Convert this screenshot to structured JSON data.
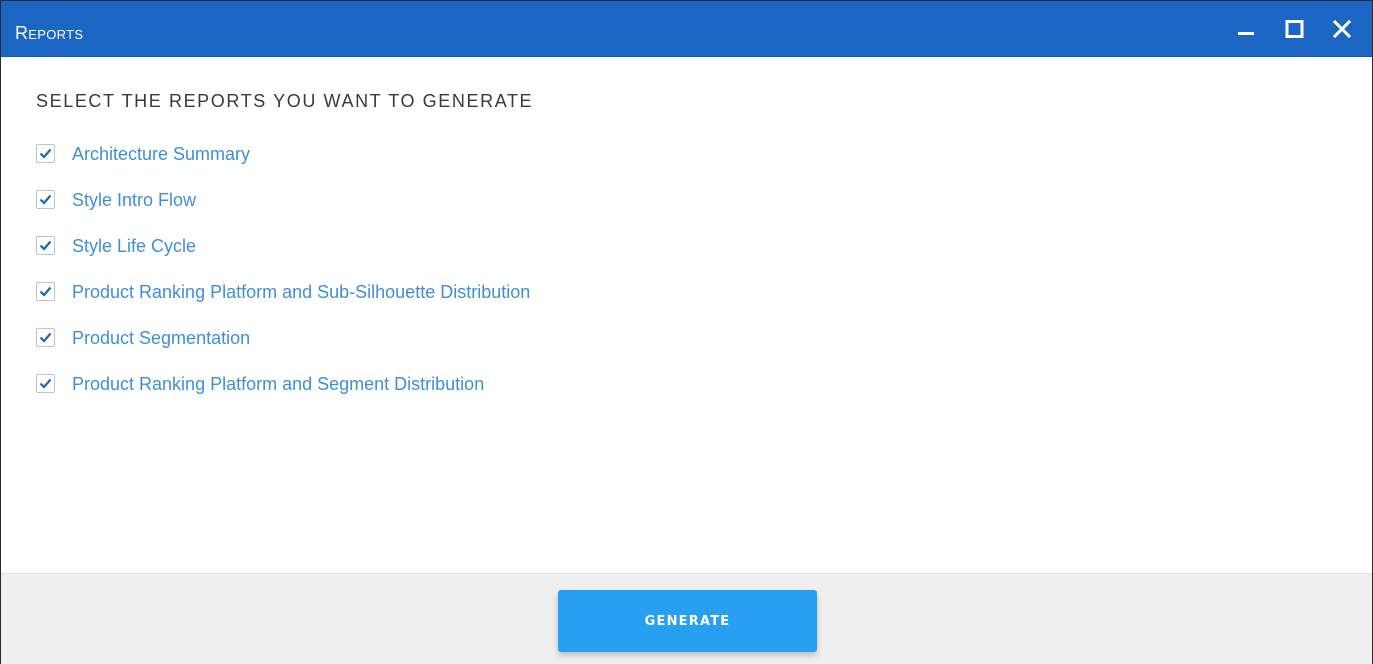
{
  "window": {
    "title": "Reports",
    "accent_color": "#1a66c2",
    "controls": [
      "minimize-icon",
      "maximize-icon",
      "close-icon"
    ]
  },
  "main": {
    "heading": "SELECT THE REPORTS YOU WANT TO GENERATE",
    "reports": [
      {
        "label": "Architecture Summary",
        "checked": true
      },
      {
        "label": "Style Intro Flow",
        "checked": true
      },
      {
        "label": "Style Life Cycle",
        "checked": true
      },
      {
        "label": "Product Ranking Platform and Sub-Silhouette Distribution",
        "checked": true
      },
      {
        "label": "Product Segmentation",
        "checked": true
      },
      {
        "label": "Product Ranking Platform and Segment Distribution",
        "checked": true
      }
    ],
    "link_color": "#3f8fd8",
    "check_color": "#1a66c2"
  },
  "footer": {
    "generate_label": "GENERATE",
    "button_color": "#27a0f2"
  }
}
